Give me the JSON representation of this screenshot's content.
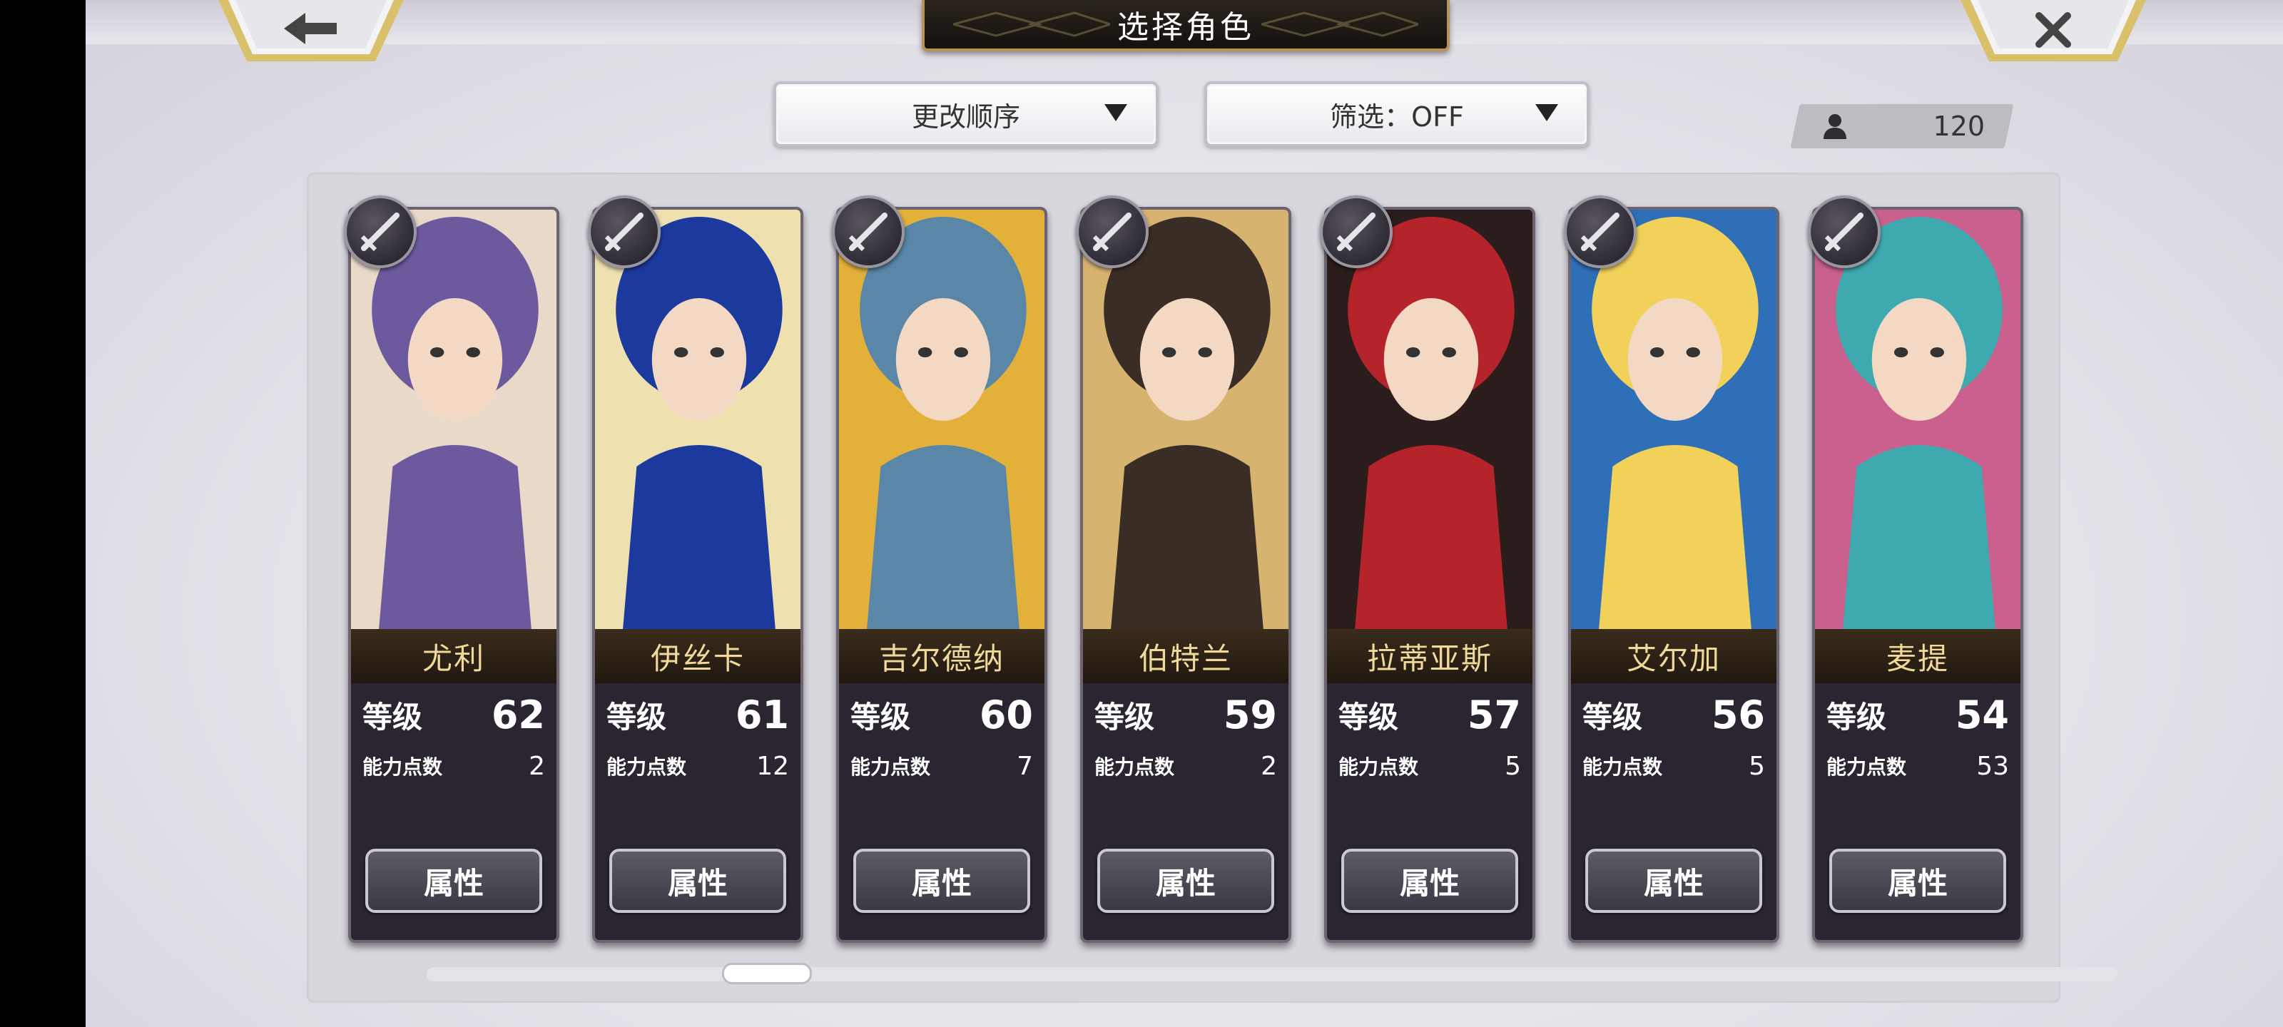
{
  "header": {
    "title": "选择角色",
    "back_icon": "back-arrow-icon",
    "close_icon": "close-icon"
  },
  "controls": {
    "sort_label": "更改顺序",
    "filter_label": "筛选：OFF",
    "character_count": "120"
  },
  "characters": [
    {
      "name": "尤利",
      "level_label": "等级",
      "level": "62",
      "ap_label": "能力点数",
      "ap": "2",
      "button": "属性",
      "weapon_icon": "sword-icon",
      "palette": [
        "#6d5a9e",
        "#e8d9c8"
      ]
    },
    {
      "name": "伊丝卡",
      "level_label": "等级",
      "level": "61",
      "ap_label": "能力点数",
      "ap": "12",
      "button": "属性",
      "weapon_icon": "sword-icon",
      "palette": [
        "#1c3a9e",
        "#efe0b0"
      ]
    },
    {
      "name": "吉尔德纳",
      "level_label": "等级",
      "level": "60",
      "ap_label": "能力点数",
      "ap": "7",
      "button": "属性",
      "weapon_icon": "greatsword-icon",
      "palette": [
        "#5a86a8",
        "#e3b03a"
      ]
    },
    {
      "name": "伯特兰",
      "level_label": "等级",
      "level": "59",
      "ap_label": "能力点数",
      "ap": "2",
      "button": "属性",
      "weapon_icon": "spear-icon",
      "palette": [
        "#3a2d26",
        "#d7b370"
      ]
    },
    {
      "name": "拉蒂亚斯",
      "level_label": "等级",
      "level": "57",
      "ap_label": "能力点数",
      "ap": "5",
      "button": "属性",
      "weapon_icon": "greatsword-icon",
      "palette": [
        "#b5242a",
        "#2b1d1b"
      ]
    },
    {
      "name": "艾尔加",
      "level_label": "等级",
      "level": "56",
      "ap_label": "能力点数",
      "ap": "5",
      "button": "属性",
      "weapon_icon": "sword-icon",
      "palette": [
        "#f2d15a",
        "#2f6fb8"
      ]
    },
    {
      "name": "麦提",
      "level_label": "等级",
      "level": "54",
      "ap_label": "能力点数",
      "ap": "53",
      "button": "属性",
      "weapon_icon": "staff-icon",
      "palette": [
        "#3eaab0",
        "#c9608e"
      ]
    }
  ]
}
